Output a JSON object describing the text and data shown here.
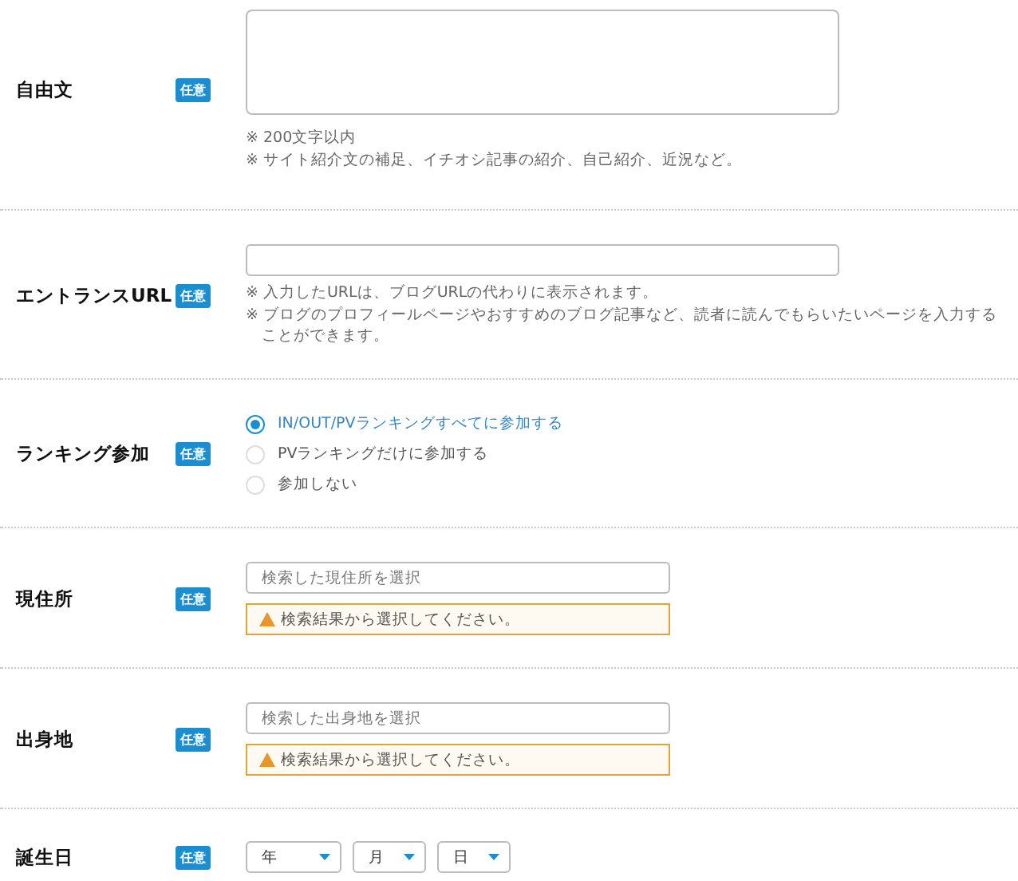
{
  "rows": [
    {
      "kind": "textarea",
      "label": "自由文",
      "badge": "任意",
      "notes": [
        "※ 200文字以内",
        "※ サイト紹介文の補足、イチオシ記事の紹介、自己紹介、近況など。"
      ]
    },
    {
      "kind": "text",
      "label": "エントランスURL",
      "badge": "任意",
      "notes": [
        "※ 入力したURLは、ブログURLの代わりに表示されます。",
        "※ ブログのプロフィールページやおすすめのブログ記事など、読者に読んでもらいたいページを入力することができます。"
      ]
    },
    {
      "kind": "radio",
      "label": "ランキング参加",
      "badge": "任意",
      "options": [
        {
          "label": "IN/OUT/PVランキングすべてに参加する",
          "selected": true
        },
        {
          "label": "PVランキングだけに参加する",
          "selected": false
        },
        {
          "label": "参加しない",
          "selected": false
        }
      ]
    },
    {
      "kind": "search",
      "label": "現住所",
      "badge": "任意",
      "placeholder": "検索した現住所を選択",
      "warning": "検索結果から選択してください。"
    },
    {
      "kind": "search",
      "label": "出身地",
      "badge": "任意",
      "placeholder": "検索した出身地を選択",
      "warning": "検索結果から選択してください。"
    },
    {
      "kind": "date",
      "label": "誕生日",
      "badge": "任意",
      "selects": [
        "年",
        "月",
        "日"
      ]
    }
  ]
}
